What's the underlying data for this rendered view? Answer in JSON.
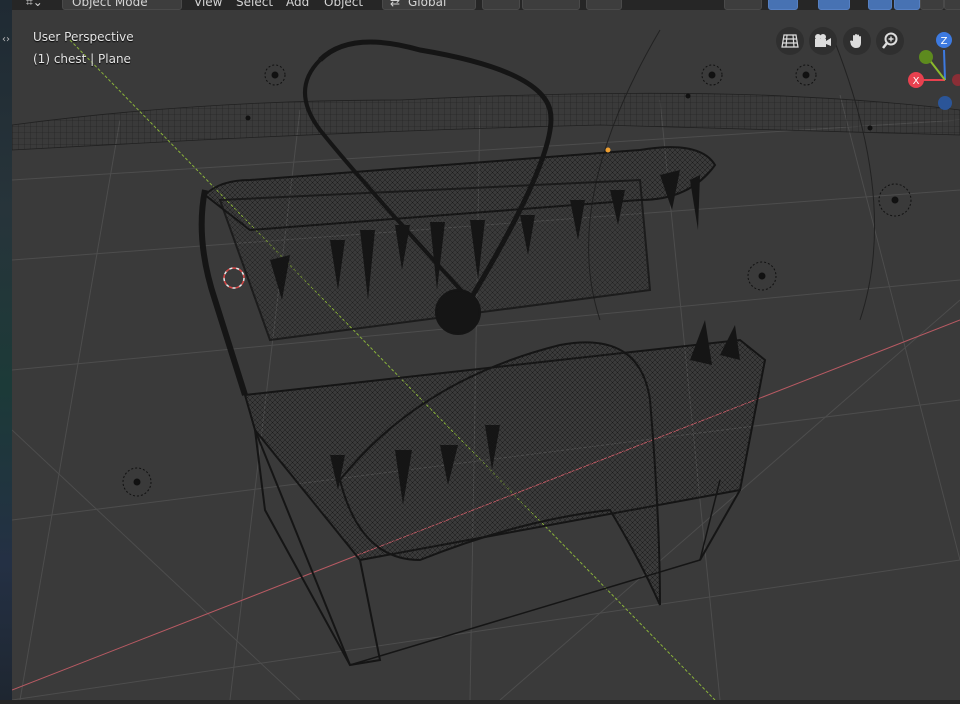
{
  "header": {
    "mode_label": "Object Mode",
    "menus": [
      "View",
      "Select",
      "Add",
      "Object"
    ],
    "transform_orientation": "Global"
  },
  "viewport": {
    "view_name": "User Perspective",
    "object_info": "(1) chest | Plane"
  },
  "gizmo": {
    "axes": {
      "x": "X",
      "y": "Y",
      "z": "Z"
    },
    "colors": {
      "x": "#e8414f",
      "y": "#8bba2c",
      "z": "#3d7ae0"
    }
  },
  "colors": {
    "background": "#3a3a3a",
    "grid": "#4d4d4d",
    "x_axis_line": "#b85a63",
    "y_axis_line": "#8ab33a",
    "wire": "#151515",
    "accent": "#4772b3"
  },
  "nav_icons": [
    "grid-icon",
    "camera-icon",
    "hand-icon",
    "zoom-icon"
  ]
}
